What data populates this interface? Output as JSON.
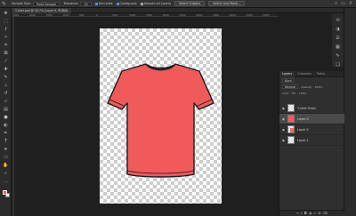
{
  "options_bar": {
    "tool_icon": "brush-icon",
    "sample_size_label": "Sample Size:",
    "sample_size_value": "Point Sample",
    "tolerance_label": "Tolerance:",
    "tolerance_value": "32",
    "anti_alias_label": "Anti-alias",
    "contiguous_label": "Contiguous",
    "sample_all_layers_label": "Sample All Layers",
    "select_subject_label": "Select Subject",
    "select_mask_label": "Select and Mask...",
    "right_icons": [
      "search-icon",
      "workspace-icon",
      "share-icon"
    ]
  },
  "document_tab": {
    "title": "T-shirt.psd @ 16.7% (Layer 0, RGB/8)"
  },
  "ruler": {
    "h_ticks": [
      "2500",
      "2000",
      "1500",
      "1000",
      "500",
      "0",
      "500",
      "1000",
      "1500",
      "2000",
      "2500",
      "3000",
      "3500",
      "4000",
      "4500",
      "5000"
    ]
  },
  "toolbar": {
    "tools": [
      "move-icon",
      "marquee-icon",
      "lasso-icon",
      "quick-select-icon",
      "crop-icon",
      "frame-icon",
      "eyedropper-icon",
      "healing-icon",
      "brush-icon",
      "stamp-icon",
      "history-brush-icon",
      "eraser-icon",
      "gradient-icon",
      "blur-icon",
      "dodge-icon",
      "pen-icon",
      "type-icon",
      "path-select-icon",
      "rectangle-icon",
      "hand-icon",
      "zoom-icon",
      "more-icon"
    ],
    "foreground_color": "#f05a5b",
    "background_color": "#ffffff"
  },
  "canvas": {
    "shirt_color": "#f05a5b",
    "outline_color": "#1a1a1a"
  },
  "icon_strip": [
    "history-icon",
    "adjustments-icon",
    "properties-icon",
    "libraries-icon",
    "brushes-icon",
    "layers-icon"
  ],
  "layers_panel": {
    "tabs": [
      "Layers",
      "Channels",
      "Paths"
    ],
    "active_tab": "Layers",
    "filter_label": "Kind",
    "blend_mode": "Normal",
    "opacity_label": "Opacity:",
    "opacity_value": "100%",
    "lock_label": "Lock:",
    "fill_label": "Fill:",
    "fill_value": "100%",
    "layers": [
      {
        "name": "T-shirt Fresh",
        "thumb": "checker",
        "selected": false
      },
      {
        "name": "Layer 0",
        "thumb": "red",
        "selected": true
      },
      {
        "name": "Layer 2",
        "thumb": "shirt",
        "selected": false
      },
      {
        "name": "Layer 1",
        "thumb": "checker",
        "selected": false
      }
    ],
    "bottom_icons": [
      "link-icon",
      "fx-icon",
      "mask-icon",
      "adjustment-icon",
      "group-icon",
      "new-layer-icon",
      "trash-icon"
    ]
  }
}
